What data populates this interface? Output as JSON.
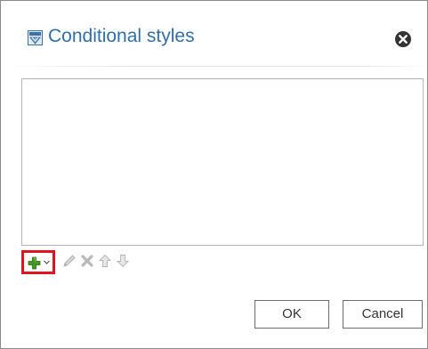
{
  "dialog": {
    "title": "Conditional styles",
    "title_icon": "conditional-styles-icon",
    "close_icon": "close-circle-icon"
  },
  "toolbar": {
    "add_icon": "plus-icon",
    "add_dropdown_icon": "chevron-down-icon",
    "edit_icon": "pencil-icon",
    "delete_icon": "x-icon",
    "move_up_icon": "arrow-up-icon",
    "move_down_icon": "arrow-down-icon",
    "highlight_color": "#e0141e"
  },
  "buttons": {
    "ok_label": "OK",
    "cancel_label": "Cancel"
  },
  "colors": {
    "title": "#2e6fad",
    "add_icon": "#3f9a1f"
  }
}
